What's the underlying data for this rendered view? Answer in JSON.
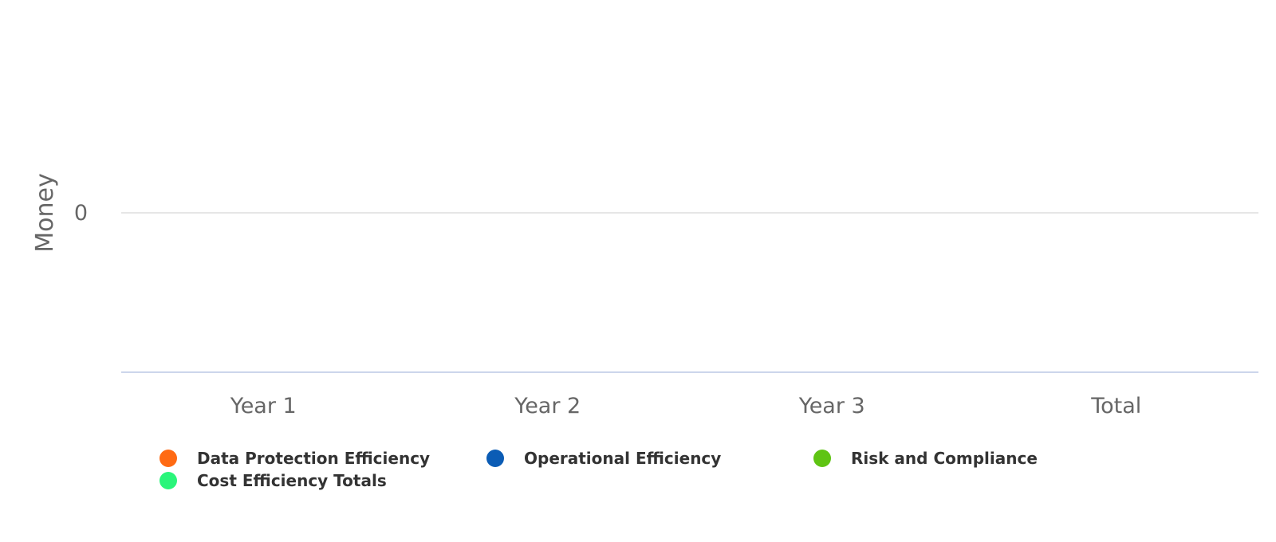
{
  "chart_data": {
    "type": "bar",
    "title": "",
    "xlabel": "",
    "ylabel": "Money",
    "categories": [
      "Year 1",
      "Year 2",
      "Year 3",
      "Total"
    ],
    "yticks": [
      "0"
    ],
    "grid": true,
    "legend_position": "bottom",
    "series": [
      {
        "name": "Data Protection Efficiency",
        "color": "#ff6a13",
        "values": [
          0,
          0,
          0,
          0
        ]
      },
      {
        "name": "Operational Efficiency",
        "color": "#0b5cb5",
        "values": [
          0,
          0,
          0,
          0
        ]
      },
      {
        "name": "Risk and Compliance",
        "color": "#5fc413",
        "values": [
          0,
          0,
          0,
          0
        ]
      },
      {
        "name": "Cost Efficiency Totals",
        "color": "#2af57a",
        "values": [
          0,
          0,
          0,
          0
        ]
      }
    ]
  }
}
